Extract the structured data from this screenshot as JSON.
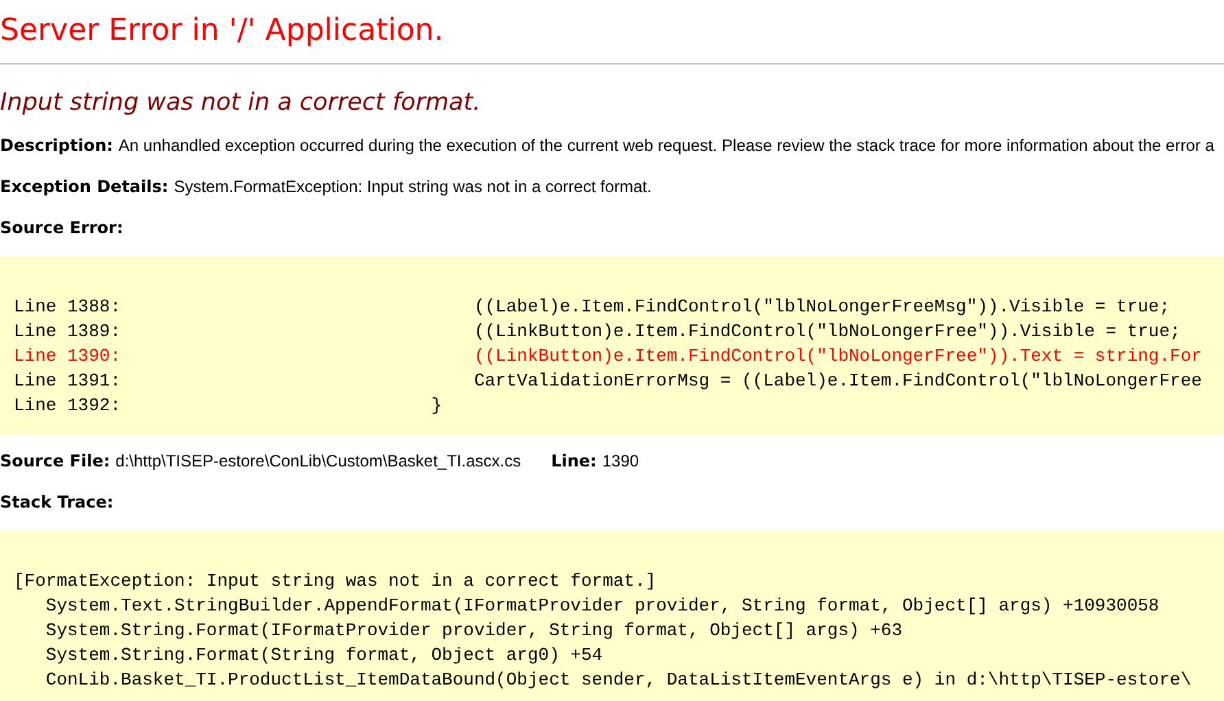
{
  "title": "Server Error in '/' Application.",
  "error_message": "Input string was not in a correct format.",
  "description": {
    "label": "Description:",
    "text": "An unhandled exception occurred during the execution of the current web request. Please review the stack trace for more information about the error a"
  },
  "exception_details": {
    "label": "Exception Details:",
    "text": "System.FormatException: Input string was not in a correct format."
  },
  "source_error": {
    "label": "Source Error:",
    "lines": [
      {
        "text": "Line 1388:                                 ((Label)e.Item.FindControl(\"lblNoLongerFreeMsg\")).Visible = true;",
        "highlighted": false
      },
      {
        "text": "Line 1389:                                 ((LinkButton)e.Item.FindControl(\"lbNoLongerFree\")).Visible = true;",
        "highlighted": false
      },
      {
        "text": "Line 1390:                                 ((LinkButton)e.Item.FindControl(\"lbNoLongerFree\")).Text = string.For",
        "highlighted": true
      },
      {
        "text": "Line 1391:                                 CartValidationErrorMsg = ((Label)e.Item.FindControl(\"lblNoLongerFree",
        "highlighted": false
      },
      {
        "text": "Line 1392:                             }",
        "highlighted": false
      }
    ]
  },
  "source_file": {
    "label": "Source File:",
    "path": "d:\\http\\TISEP-estore\\ConLib\\Custom\\Basket_TI.ascx.cs",
    "line_label": "Line:",
    "line": "1390"
  },
  "stack_trace": {
    "label": "Stack Trace:",
    "lines": [
      "[FormatException: Input string was not in a correct format.]",
      "   System.Text.StringBuilder.AppendFormat(IFormatProvider provider, String format, Object[] args) +10930058",
      "   System.String.Format(IFormatProvider provider, String format, Object[] args) +63",
      "   System.String.Format(String format, Object arg0) +54",
      "   ConLib.Basket_TI.ProductList_ItemDataBound(Object sender, DataListItemEventArgs e) in d:\\http\\TISEP-estore\\"
    ]
  }
}
